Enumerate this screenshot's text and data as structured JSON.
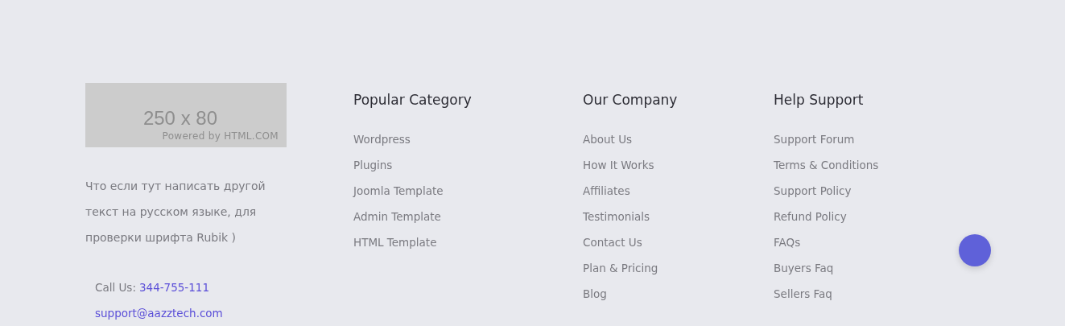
{
  "logo": {
    "size": "250 x 80",
    "credit": "Powered by HTML.COM"
  },
  "about": "Что если тут написать другой текст на русском языке, для проверки шрифта Rubik )",
  "contact": {
    "phone_label": "Call Us:",
    "phone": "344-755-111",
    "email": "support@aazztech.com"
  },
  "columns": [
    {
      "title": "Popular Category",
      "links": [
        "Wordpress",
        "Plugins",
        "Joomla Template",
        "Admin Template",
        "HTML Template"
      ]
    },
    {
      "title": "Our Company",
      "links": [
        "About Us",
        "How It Works",
        "Affiliates",
        "Testimonials",
        "Contact Us",
        "Plan & Pricing",
        "Blog"
      ]
    },
    {
      "title": "Help Support",
      "links": [
        "Support Forum",
        "Terms & Conditions",
        "Support Policy",
        "Refund Policy",
        "FAQs",
        "Buyers Faq",
        "Sellers Faq"
      ]
    }
  ]
}
